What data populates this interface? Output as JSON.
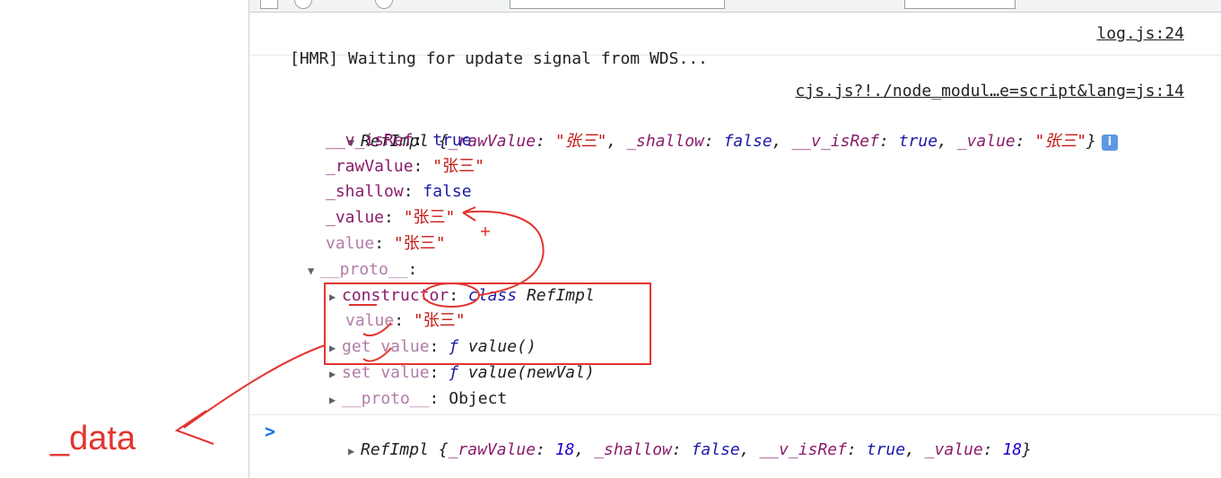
{
  "console": {
    "hmr_message": "[HMR] Waiting for update signal from WDS...",
    "hmr_source": "log.js:24",
    "obj_source": "cjs.js?!./node_modul…e=script&lang=js:14",
    "ref1": {
      "summary_prefix": "RefImpl",
      "summary_open": " {",
      "summary_k1": "_rawValue",
      "summary_v1": "\"张三\"",
      "summary_k2": "_shallow",
      "summary_v2": "false",
      "summary_k3": "__v_isRef",
      "summary_v3": "true",
      "summary_k4": "_value",
      "summary_v4": "\"张三\"",
      "summary_close": "}",
      "info_icon_glyph": "i",
      "props": [
        {
          "key": "__v_isRef",
          "value": "true"
        },
        {
          "key": "_rawValue",
          "value": "\"张三\""
        },
        {
          "key": "_shallow",
          "value": "false"
        },
        {
          "key": "_value",
          "value": "\"张三\""
        },
        {
          "key": "value",
          "value": "\"张三\""
        }
      ],
      "proto_label": "__proto__",
      "proto_items": {
        "constructor_key": "constructor",
        "constructor_val_kw": "class",
        "constructor_val_name": "RefImpl",
        "value_key": "value",
        "value_val": "\"张三\"",
        "get_key": "get value",
        "get_f": "ƒ",
        "get_sig": "value()",
        "set_key": "set value",
        "set_f": "ƒ",
        "set_sig": "value(newVal)",
        "proto2_key": "__proto__",
        "proto2_val": "Object"
      }
    },
    "ref2": {
      "prefix": "RefImpl",
      "open": " {",
      "k1": "_rawValue",
      "v1": "18",
      "k2": "_shallow",
      "v2": "false",
      "k3": "__v_isRef",
      "v3": "true",
      "k4": "_value",
      "v4": "18",
      "close": "}"
    },
    "prompt_glyph": ">"
  },
  "annotation": {
    "label": "_data",
    "color": "#e3342f"
  }
}
